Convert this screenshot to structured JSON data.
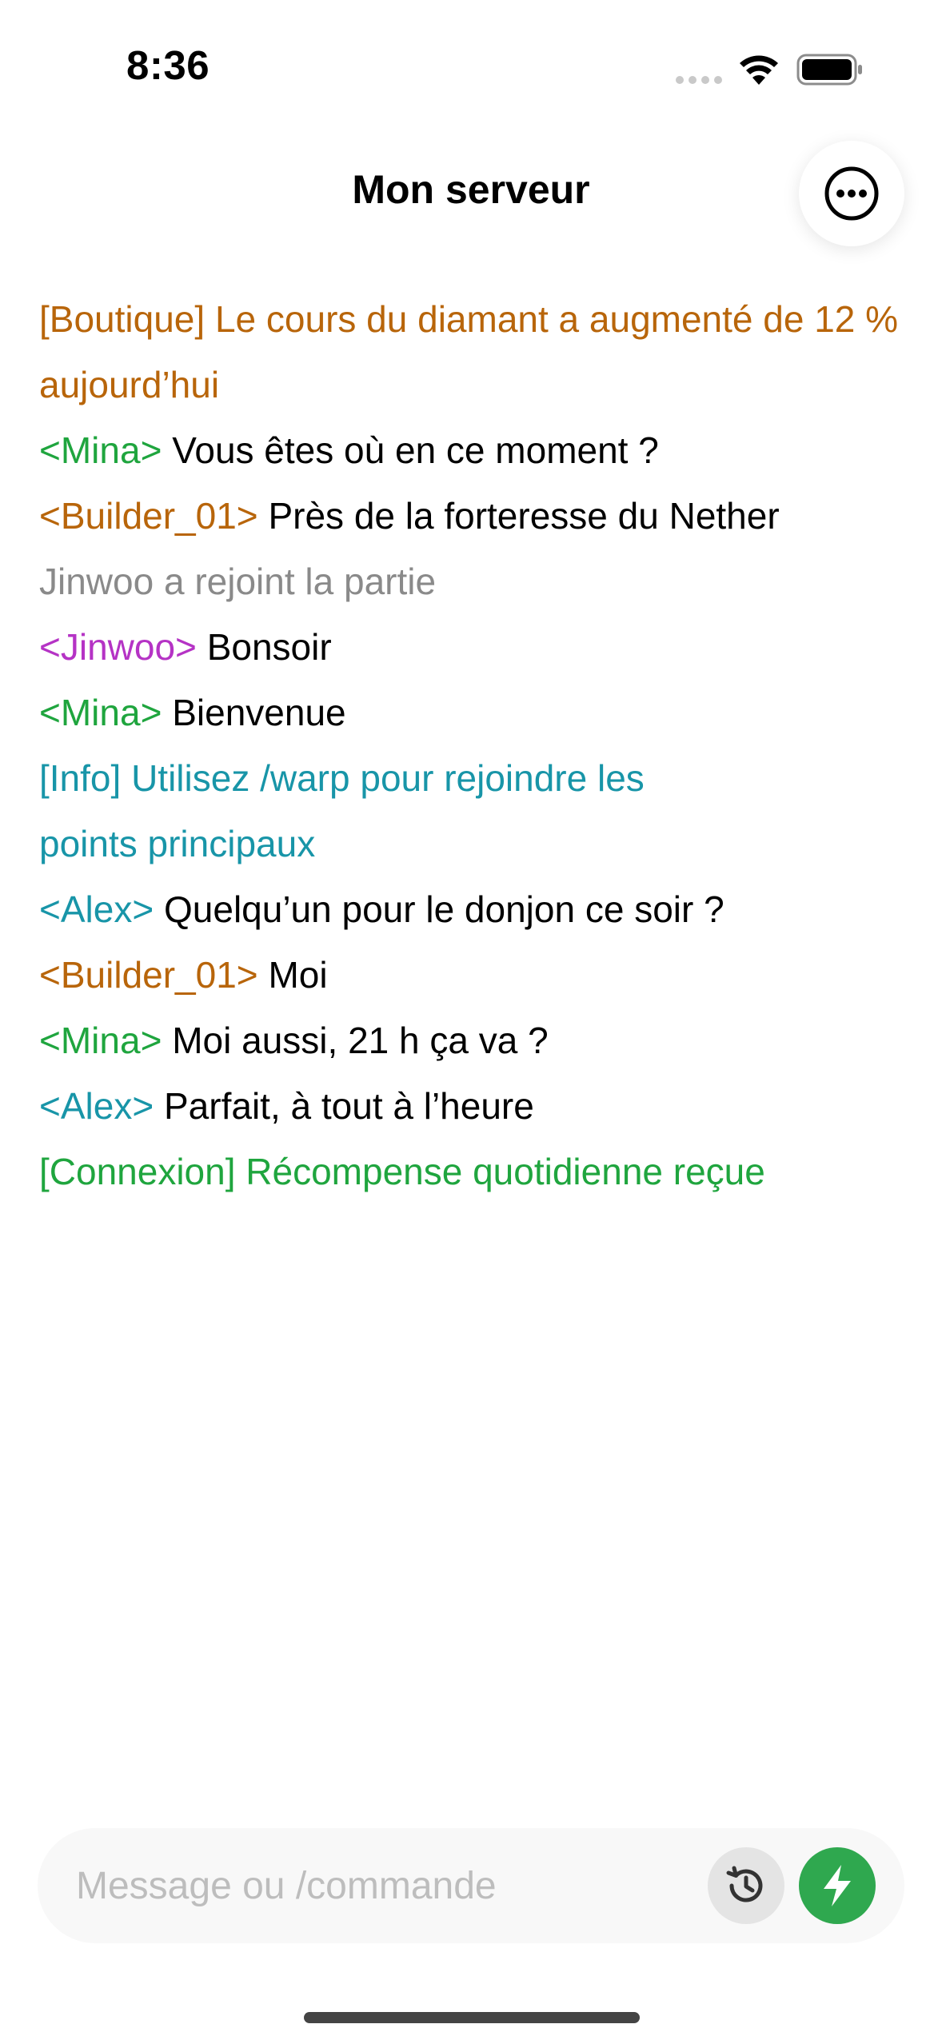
{
  "status_bar": {
    "time": "8:36"
  },
  "header": {
    "title": "Mon serveur",
    "more_icon": "ellipsis-circle-icon"
  },
  "chat": [
    {
      "prefix": "[Boutique]",
      "prefix_color": "#B8650A",
      "text": " Le cours du diamant a augmenté de 12 % aujourd’hui",
      "text_color": "#B8650A"
    },
    {
      "prefix": "<Mina>",
      "prefix_color": "#1FA53E",
      "text": " Vous êtes où en ce moment ?",
      "text_color": "#000000"
    },
    {
      "prefix": "<Builder_01>",
      "prefix_color": "#B8650A",
      "text": " Près de la forteresse du Nether",
      "text_color": "#000000"
    },
    {
      "prefix": "",
      "prefix_color": "#8A8A8A",
      "text": "Jinwoo a rejoint la partie",
      "text_color": "#8A8A8A"
    },
    {
      "prefix": "<Jinwoo>",
      "prefix_color": "#B533C5",
      "text": " Bonsoir",
      "text_color": "#000000"
    },
    {
      "prefix": "<Mina>",
      "prefix_color": "#1FA53E",
      "text": " Bienvenue",
      "text_color": "#000000"
    },
    {
      "prefix": "[Info]",
      "prefix_color": "#1895A8",
      "text": " Utilisez /warp pour rejoindre les points principaux",
      "text_color": "#1895A8"
    },
    {
      "prefix": "<Alex>",
      "prefix_color": "#1895A8",
      "text": " Quelqu’un pour le donjon ce soir ?",
      "text_color": "#000000"
    },
    {
      "prefix": "<Builder_01>",
      "prefix_color": "#B8650A",
      "text": " Moi",
      "text_color": "#000000"
    },
    {
      "prefix": "<Mina>",
      "prefix_color": "#1FA53E",
      "text": " Moi aussi, 21 h ça va ?",
      "text_color": "#000000"
    },
    {
      "prefix": "<Alex>",
      "prefix_color": "#1895A8",
      "text": " Parfait, à tout à l’heure",
      "text_color": "#000000"
    },
    {
      "prefix": "[Connexion]",
      "prefix_color": "#1FA53E",
      "text": " Récompense quotidienne reçue",
      "text_color": "#1FA53E"
    }
  ],
  "composer": {
    "placeholder": "Message ou /commande",
    "value": "",
    "history_icon": "history-icon",
    "send_icon": "bolt-icon",
    "send_color": "#2FA84F"
  }
}
